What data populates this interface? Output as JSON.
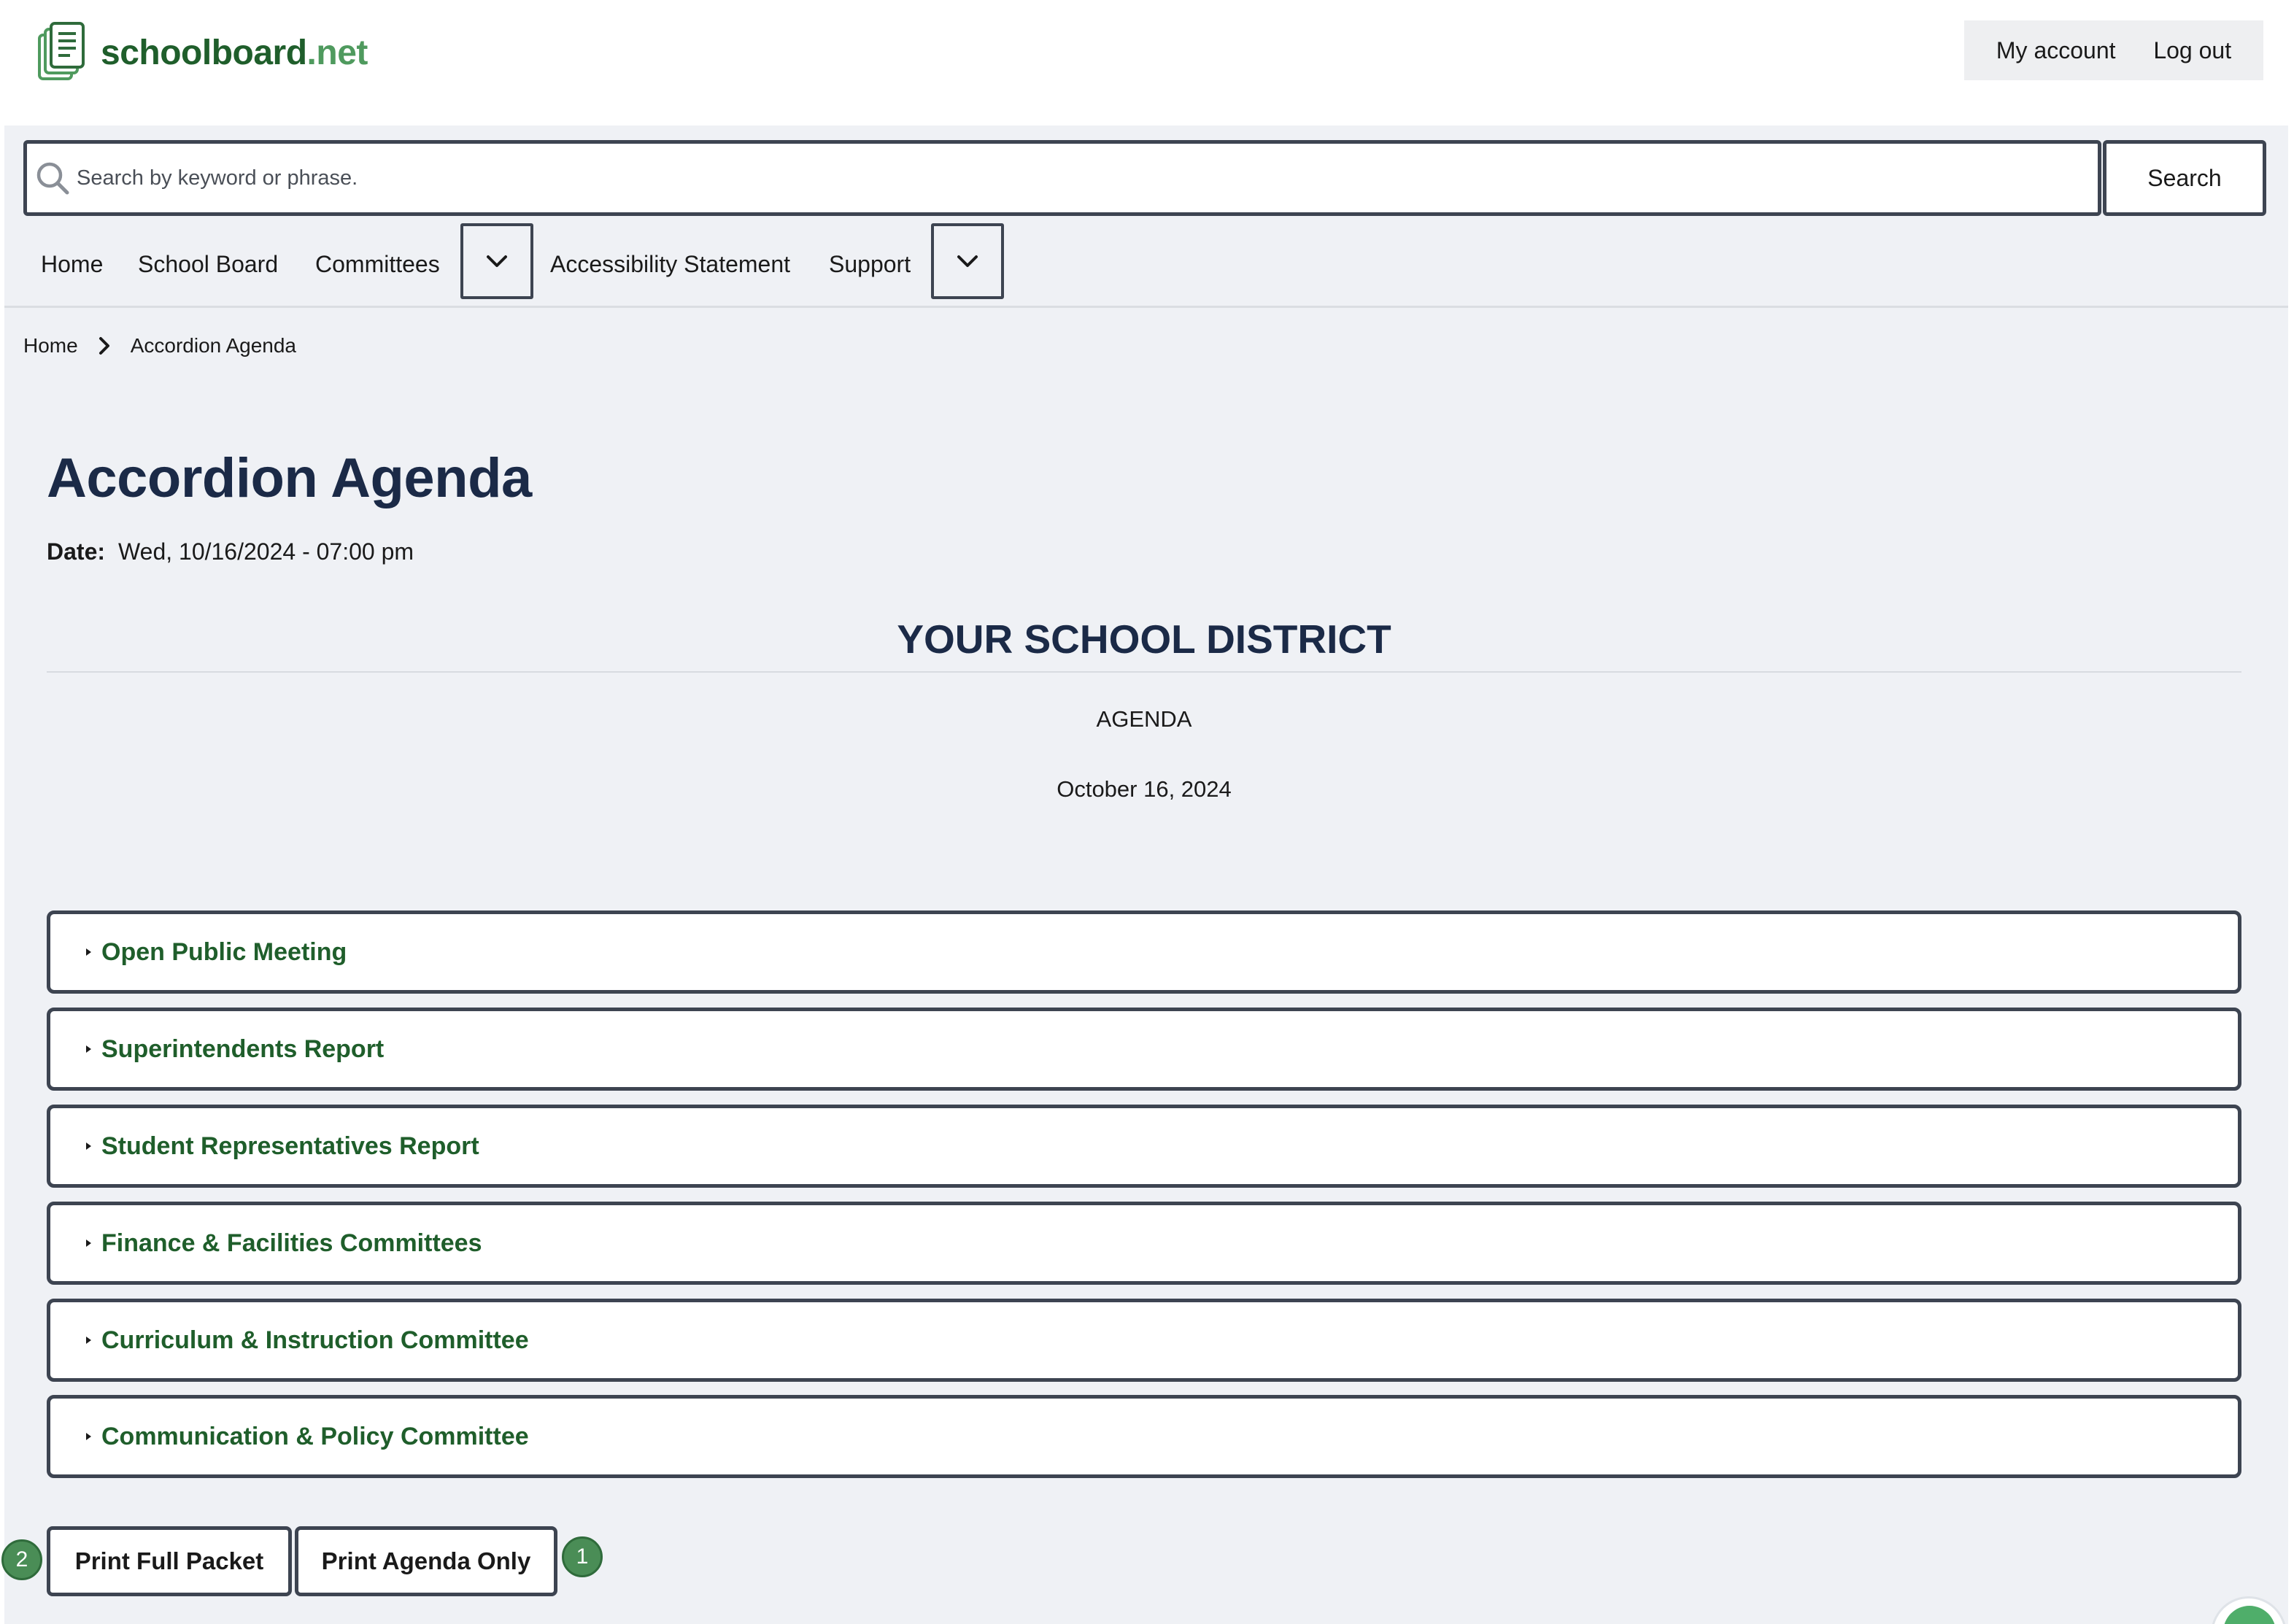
{
  "header": {
    "logo_name": "schoolboard",
    "logo_tld": ".net",
    "account": {
      "my_account": "My account",
      "log_out": "Log out"
    }
  },
  "search": {
    "placeholder": "Search by keyword or phrase.",
    "value": "",
    "button_label": "Search"
  },
  "nav": {
    "items": [
      {
        "label": "Home"
      },
      {
        "label": "School Board"
      },
      {
        "label": "Committees"
      },
      {
        "label": "Accessibility Statement"
      },
      {
        "label": "Support"
      }
    ]
  },
  "breadcrumb": {
    "home": "Home",
    "current": "Accordion Agenda"
  },
  "page": {
    "title": "Accordion Agenda",
    "date_label": "Date:",
    "date_value": "Wed, 10/16/2024 - 07:00 pm",
    "district": "YOUR SCHOOL DISTRICT",
    "agenda_label": "AGENDA",
    "agenda_date": "October 16, 2024"
  },
  "accordion": {
    "sections": [
      {
        "label": "Open Public Meeting"
      },
      {
        "label": "Superintendents Report"
      },
      {
        "label": "Student Representatives Report"
      },
      {
        "label": "Finance & Facilities Committees"
      },
      {
        "label": "Curriculum & Instruction Committee"
      },
      {
        "label": "Communication & Policy Committee"
      }
    ]
  },
  "actions": {
    "print_full_packet": "Print Full Packet",
    "print_agenda_only": "Print Agenda Only",
    "badge_full_packet": "2",
    "badge_agenda_only": "1"
  },
  "colors": {
    "brand_green": "#1f5e2b",
    "brand_green_light": "#4f9a5e",
    "heading_navy": "#1b2a47",
    "page_background": "#eff1f5",
    "border_dark": "#3d4451",
    "badge_green": "#4a8d56"
  },
  "icons": {
    "logo": "stacked-documents-icon",
    "search": "search-icon",
    "dropdown": "chevron-down-icon",
    "breadcrumb_separator": "chevron-right-icon",
    "accordion_toggle": "caret-right-icon",
    "chat": "chat-icon"
  }
}
